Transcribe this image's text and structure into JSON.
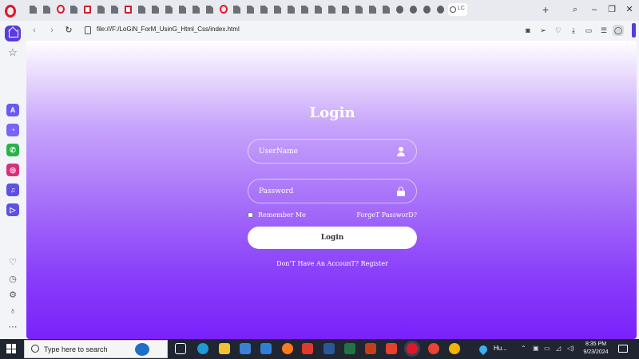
{
  "browser": {
    "url": "file:///F:/LoGiN_ForM_UsinG_Html_Css/index.html",
    "active_tab_label": "LC",
    "new_tab_label": "+",
    "tabs": [
      "doc",
      "doc",
      "opera",
      "doc",
      "red",
      "doc",
      "doc",
      "red",
      "doc",
      "doc",
      "doc",
      "doc",
      "doc",
      "doc",
      "opera",
      "doc",
      "doc",
      "doc",
      "doc",
      "doc",
      "doc",
      "doc",
      "doc",
      "doc",
      "doc",
      "doc",
      "doc",
      "globe",
      "globe",
      "globe",
      "globe",
      "active"
    ]
  },
  "page": {
    "title": "Login",
    "username_placeholder": "UserName",
    "password_placeholder": "Password",
    "remember_label": "Remember Me",
    "forgot_label": "ForgeT PassworD?",
    "login_button": "Login",
    "register_text": "Don'T Have An AccounT? Register"
  },
  "taskbar": {
    "search_placeholder": "Type here to search",
    "weather": "Hu...",
    "time": "8:35 PM",
    "date": "9/23/2024"
  },
  "colors": {
    "accent": "#5b3bdc",
    "gradient_end": "#7a21fb"
  }
}
